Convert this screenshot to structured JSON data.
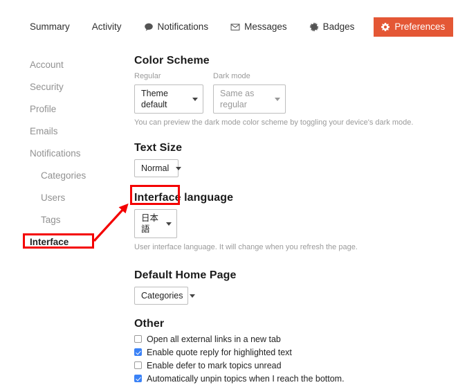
{
  "tabs": [
    {
      "label": "Summary",
      "icon": null,
      "active": false
    },
    {
      "label": "Activity",
      "icon": null,
      "active": false
    },
    {
      "label": "Notifications",
      "icon": "speech-bubble-icon",
      "active": false
    },
    {
      "label": "Messages",
      "icon": "envelope-icon",
      "active": false
    },
    {
      "label": "Badges",
      "icon": "rosette-icon",
      "active": false
    },
    {
      "label": "Preferences",
      "icon": "gear-icon",
      "active": true
    }
  ],
  "sidebar": {
    "items": [
      {
        "label": "Account",
        "indent": false,
        "active": false
      },
      {
        "label": "Security",
        "indent": false,
        "active": false
      },
      {
        "label": "Profile",
        "indent": false,
        "active": false
      },
      {
        "label": "Emails",
        "indent": false,
        "active": false
      },
      {
        "label": "Notifications",
        "indent": false,
        "active": false
      },
      {
        "label": "Categories",
        "indent": true,
        "active": false
      },
      {
        "label": "Users",
        "indent": true,
        "active": false
      },
      {
        "label": "Tags",
        "indent": true,
        "active": false
      },
      {
        "label": "Interface",
        "indent": false,
        "active": true
      }
    ]
  },
  "main": {
    "color_scheme": {
      "heading": "Color Scheme",
      "regular_label": "Regular",
      "regular_value": "Theme default",
      "dark_label": "Dark mode",
      "dark_value": "Same as regular",
      "help": "You can preview the dark mode color scheme by toggling your device's dark mode."
    },
    "text_size": {
      "heading": "Text Size",
      "value": "Normal"
    },
    "interface_language": {
      "heading": "Interface language",
      "value": "日本語",
      "help": "User interface language. It will change when you refresh the page."
    },
    "default_home_page": {
      "heading": "Default Home Page",
      "value": "Categories"
    },
    "other": {
      "heading": "Other",
      "options": [
        {
          "label": "Open all external links in a new tab",
          "checked": false
        },
        {
          "label": "Enable quote reply for highlighted text",
          "checked": true
        },
        {
          "label": "Enable defer to mark topics unread",
          "checked": false
        },
        {
          "label": "Automatically unpin topics when I reach the bottom.",
          "checked": true
        }
      ]
    }
  },
  "annotations": {
    "highlight_color": "#f40000",
    "boxes": [
      "interface-language-dropdown",
      "sidebar-item-interface"
    ],
    "arrow": "sidebar-interface-to-language-dropdown"
  },
  "colors": {
    "accent": "#e45735",
    "checkbox": "#3b82f6",
    "muted_text": "#919191",
    "annotation": "#f40000"
  }
}
